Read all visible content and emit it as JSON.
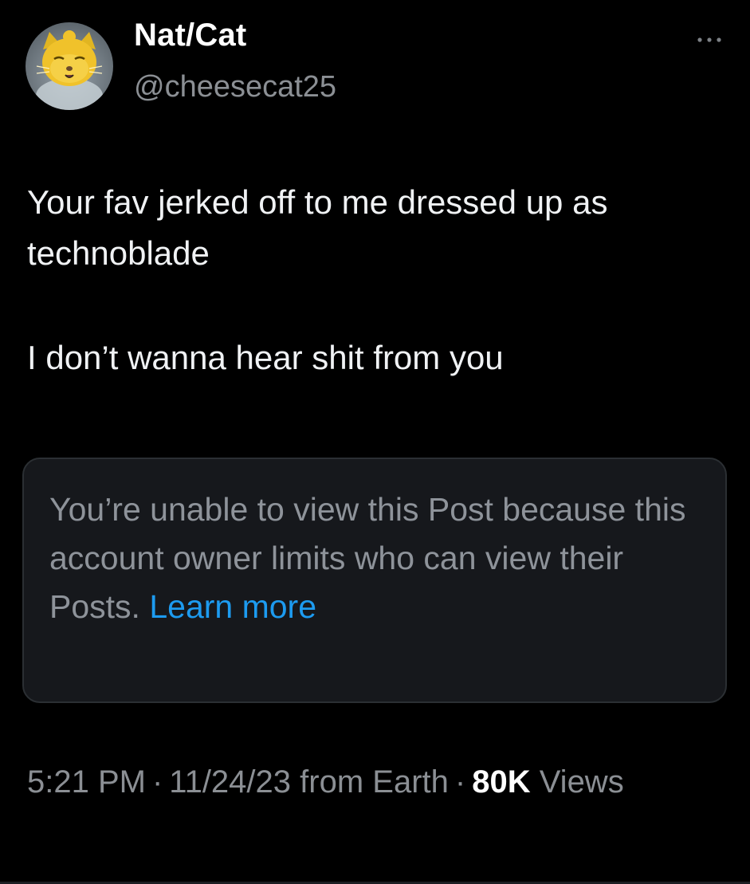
{
  "post": {
    "author": {
      "display_name": "Nat/Cat",
      "handle": "@cheesecat25",
      "avatar_icon": "cat-avatar"
    },
    "more_icon": "more-horizontal-icon",
    "text": {
      "line1": "Your fav jerked off to me dressed up as technoblade",
      "line2": "I don’t wanna hear shit from you"
    },
    "quoted_unavailable": {
      "message": "You’re unable to view this Post because this account owner limits who can view their Posts.",
      "link_label": "Learn more"
    },
    "meta": {
      "time": "5:21 PM",
      "separator": "·",
      "date": "11/24/23",
      "source": "from Earth",
      "views_count": "80K",
      "views_label": "Views"
    }
  },
  "colors": {
    "background": "#000000",
    "text_primary": "#e7e9ea",
    "text_secondary": "#8b8f94",
    "link": "#1d9bf0",
    "card_background": "#16181c"
  }
}
